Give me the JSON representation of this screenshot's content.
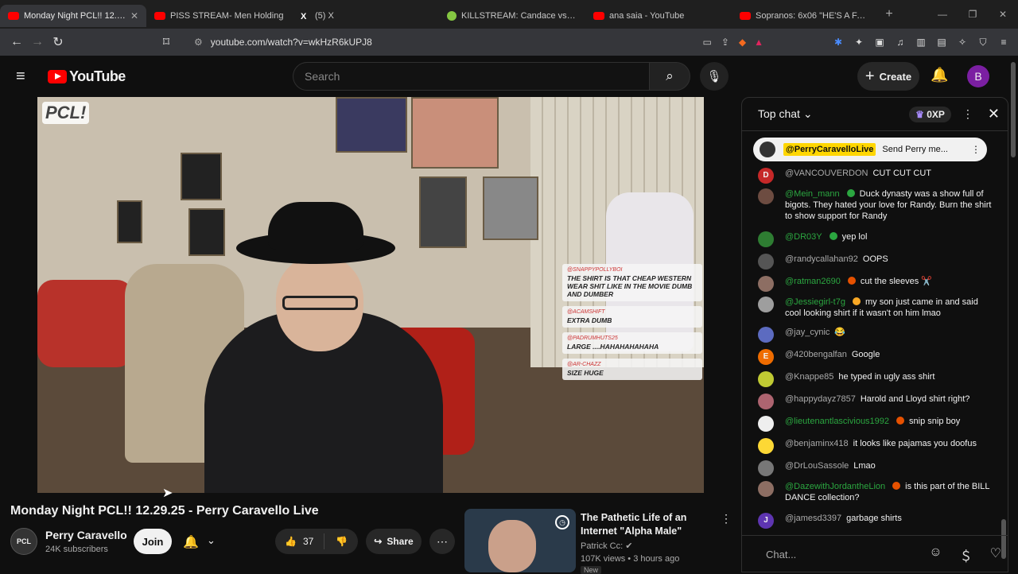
{
  "browser": {
    "tabs": [
      {
        "label": "Monday Night PCL!! 12.2...",
        "icon": "youtube-icon",
        "color": "#ff0000",
        "active": true
      },
      {
        "label": "PISS STREAM- Men Holding",
        "icon": "youtube-icon",
        "color": "#ff0000"
      },
      {
        "label": "(5) X",
        "icon": "x-icon",
        "color": "#ffffff"
      },
      {
        "label": "KILLSTREAM: Candace vs Al...",
        "icon": "rumble-icon",
        "color": "#85c742"
      },
      {
        "label": "ana saia - YouTube",
        "icon": "youtube-icon",
        "color": "#ff0000"
      },
      {
        "label": "Sopranos: 6x06 \"HE'S A FAAAG\"",
        "icon": "youtube-icon",
        "color": "#ff0000"
      }
    ],
    "url": "youtube.com/watch?v=wkHzR6kUPJ8"
  },
  "header": {
    "logo_text": "YouTube",
    "search_placeholder": "Search",
    "create_label": "Create",
    "avatar_letter": "B"
  },
  "video": {
    "watermark": "PCL!",
    "overlay_messages": [
      {
        "user": "@SNAPPYPOLLYBOI",
        "text": "The shirt is that cheap western wear shit like in the movie dumb and dumber"
      },
      {
        "user": "@ACAMSHIFT",
        "text": "Extra dumb"
      },
      {
        "user": "@PADRUMHUTS25",
        "text": "Large ....hahahahahaha"
      },
      {
        "user": "@AR-CHAZZ",
        "text": "Size huge"
      }
    ],
    "title": "Monday Night PCL!! 12.29.25 - Perry Caravello Live"
  },
  "channel": {
    "name": "Perry Caravello",
    "subscribers": "24K subscribers",
    "join_label": "Join",
    "likes": "37",
    "share_label": "Share"
  },
  "recommendation": {
    "title": "The Pathetic Life of an Internet \"Alpha Male\"",
    "channel": "Patrick Cc:",
    "meta": "107K views • 3 hours ago",
    "badge": "New"
  },
  "chat": {
    "header": "Top chat",
    "xp": "0XP",
    "pinned": {
      "user": "@PerryCaravelloLive",
      "text": "Send Perry me..."
    },
    "messages": [
      {
        "user": "@VANCOUVERDON",
        "text": "CUT CUT CUT",
        "avatar": "D",
        "color": "#c62828",
        "namecolor": "gray"
      },
      {
        "user": "@Mein_mann",
        "text": "Duck dynasty was a show full of bigots. They hated your love for Randy. Burn the shirt to show support for Randy",
        "avatar": "",
        "color": "#6d4c41",
        "namecolor": "green",
        "badge": "#2ba640"
      },
      {
        "user": "@DR03Y",
        "text": "yep lol",
        "avatar": "",
        "color": "#2e7d32",
        "namecolor": "green",
        "badge": "#2ba640"
      },
      {
        "user": "@randycallahan92",
        "text": "OOPS",
        "avatar": "",
        "color": "#555555",
        "namecolor": "gray"
      },
      {
        "user": "@ratman2690",
        "text": "cut the sleeves ✂️",
        "avatar": "",
        "color": "#8d6e63",
        "namecolor": "green",
        "badge": "#e65100"
      },
      {
        "user": "@Jessiegirl-t7g",
        "text": "my son just came in and said cool looking shirt if it wasn't on him lmao",
        "avatar": "",
        "color": "#9e9e9e",
        "namecolor": "green",
        "badge": "#f9a825"
      },
      {
        "user": "@jay_cynic",
        "text": "😂",
        "avatar": "",
        "color": "#5c6bc0",
        "namecolor": "gray"
      },
      {
        "user": "@420bengalfan",
        "text": "Google",
        "avatar": "E",
        "color": "#ef6c00",
        "namecolor": "gray"
      },
      {
        "user": "@Knappe85",
        "text": "he typed in ugly ass shirt",
        "avatar": "",
        "color": "#c0ca33",
        "namecolor": "gray"
      },
      {
        "user": "@happydayz7857",
        "text": "Harold and Lloyd shirt right?",
        "avatar": "",
        "color": "#ad6470",
        "namecolor": "gray"
      },
      {
        "user": "@lieutenantlascivious1992",
        "text": "snip snip boy",
        "avatar": "",
        "color": "#eeeeee",
        "namecolor": "green",
        "badge": "#e65100"
      },
      {
        "user": "@benjaminx418",
        "text": "it looks like pajamas you doofus",
        "avatar": "",
        "color": "#fdd835",
        "namecolor": "gray"
      },
      {
        "user": "@DrLouSassole",
        "text": "Lmao",
        "avatar": "",
        "color": "#777777",
        "namecolor": "gray"
      },
      {
        "user": "@DazewithJordantheLion",
        "text": "is this part of the BILL DANCE collection?",
        "avatar": "",
        "color": "#8d6e63",
        "namecolor": "green",
        "badge": "#e65100"
      },
      {
        "user": "@jamesd3397",
        "text": "garbage shirts",
        "avatar": "J",
        "color": "#5e35b1",
        "namecolor": "gray"
      }
    ],
    "input_placeholder": "Chat..."
  }
}
